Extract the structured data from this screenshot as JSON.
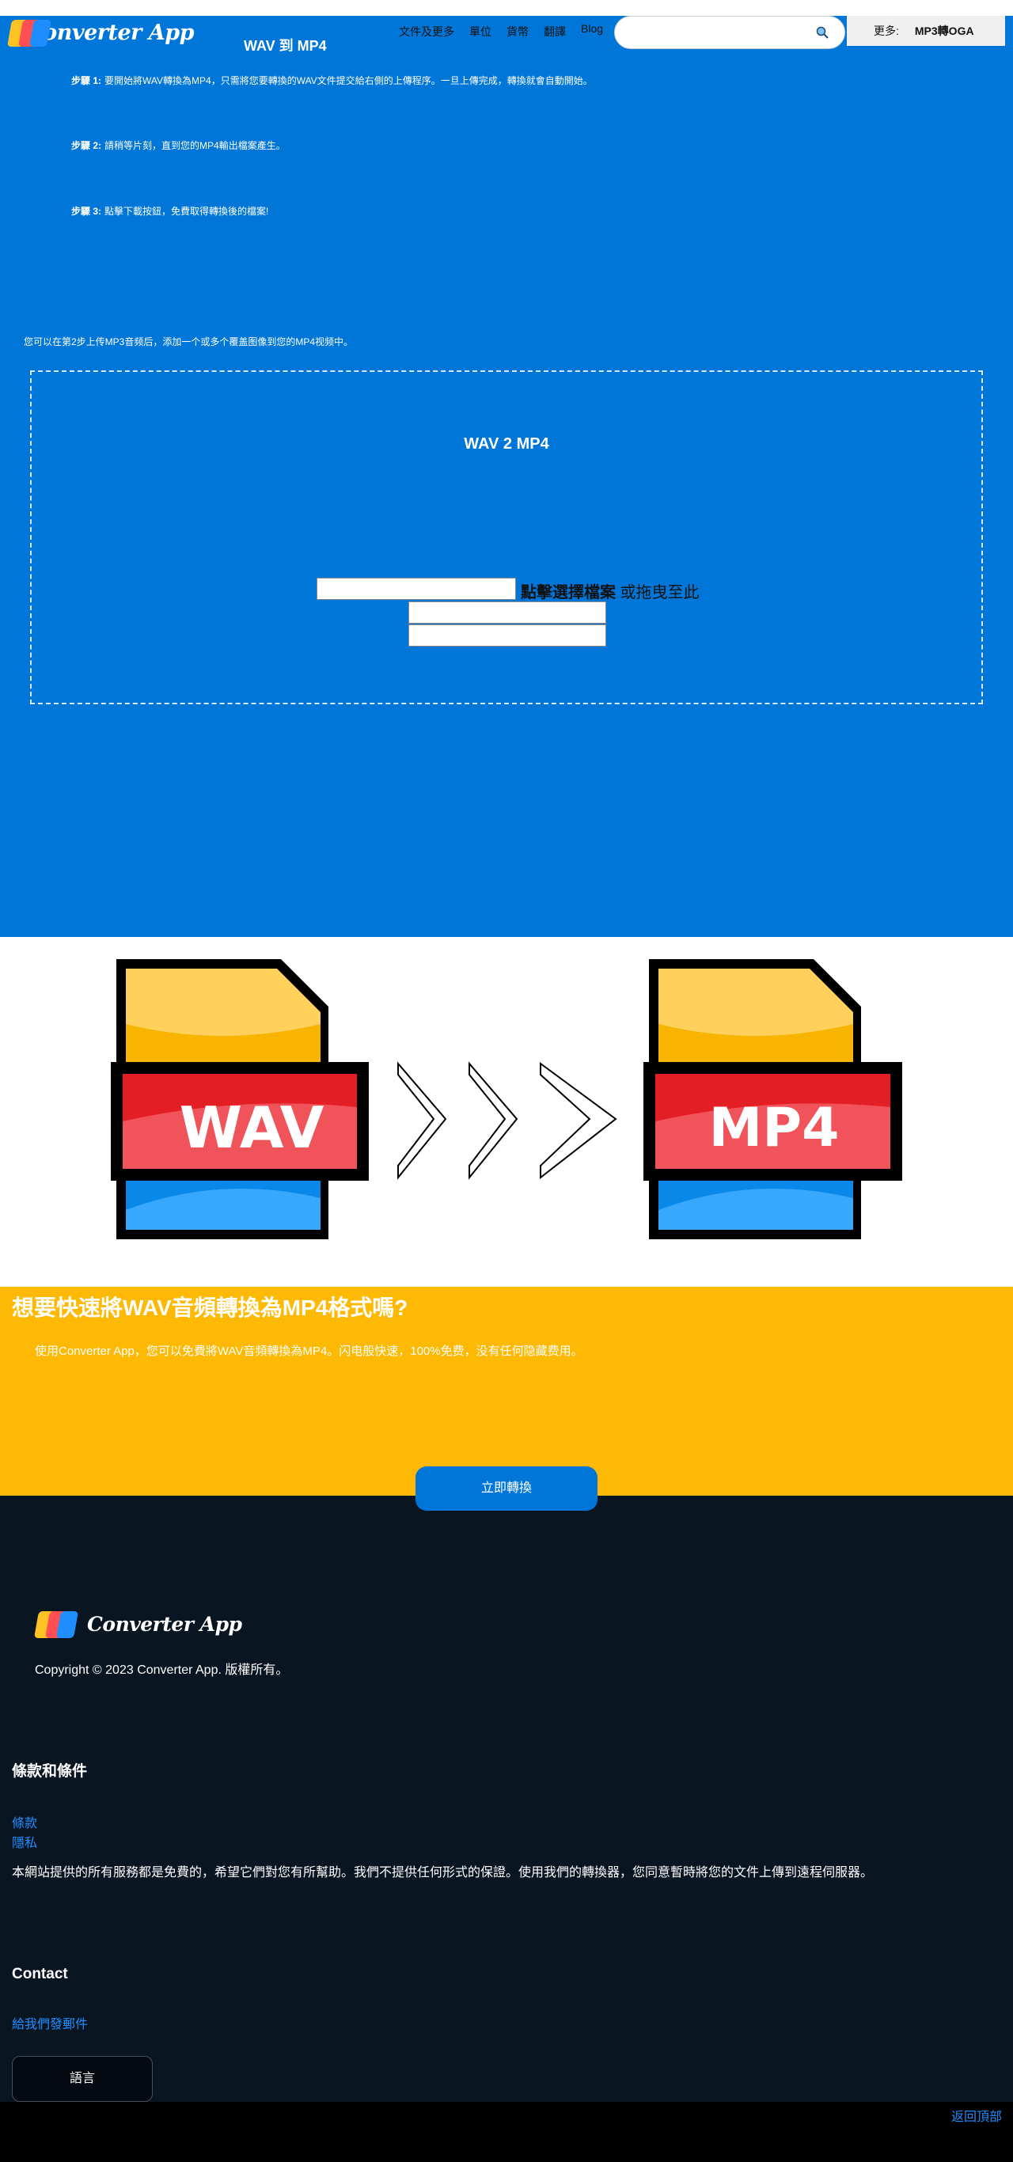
{
  "header": {
    "logo_text": "Converter App",
    "page_title": "WAV 到 MP4",
    "nav": [
      "文件及更多",
      "單位",
      "貨幣",
      "翻譯",
      "Blog"
    ],
    "search": {
      "placeholder": "",
      "icon": "search-icon"
    },
    "more_label": "更多:",
    "more_link": "MP3轉OGA"
  },
  "steps": [
    {
      "label": "步驟 1:",
      "text": "要開始將WAV轉換為MP4，只需將您要轉換的WAV文件提交給右側的上傳程序。一旦上傳完成，轉換就會自動開始。"
    },
    {
      "label": "步驟 2:",
      "text": "請稍等片刻，直到您的MP4輸出檔案產生。"
    },
    {
      "label": "步驟 3:",
      "text": "點擊下載按鈕，免費取得轉換後的檔案!"
    }
  ],
  "note": "您可以在第2步上传MP3音频后，添加一个或多个覆盖图像到您的MP4视频中。",
  "dropzone": {
    "title": "WAV 2 MP4",
    "choose_label": "點擊選擇檔案",
    "drag_label": " 或拖曳至此"
  },
  "illustration": {
    "from_format": "WAV",
    "to_format": "MP4",
    "colors": {
      "yellow": "#ffc22c",
      "red": "#e3262a",
      "blue": "#1591f0"
    }
  },
  "promo": {
    "heading": "想要快速將WAV音頻轉換為MP4格式嗎?",
    "text": "使用Converter App，您可以免費將WAV音頻轉換為MP4。闪电般快速，100%免费，没有任何隐藏费用。",
    "cta": "立即轉換"
  },
  "footer": {
    "logo_text": "Converter App",
    "copyright": "Copyright © 2023 Converter App. 版權所有。",
    "terms_heading": "條款和條件",
    "terms_link": "條款",
    "privacy_link": "隱私",
    "disclaimer": "本網站提供的所有服務都是免費的，希望它們對您有所幫助。我們不提供任何形式的保證。使用我們的轉換器，您同意暫時將您的文件上傳到遠程伺服器。",
    "contact_heading": "Contact",
    "mail_link": "給我們發郵件",
    "language_button": "語言",
    "back_to_top": "返回頂部"
  },
  "colors": {
    "primary_blue": "#0077d8",
    "promo_yellow": "#fdb903",
    "footer_bg": "#0a1522",
    "link_blue": "#1e8eff"
  }
}
